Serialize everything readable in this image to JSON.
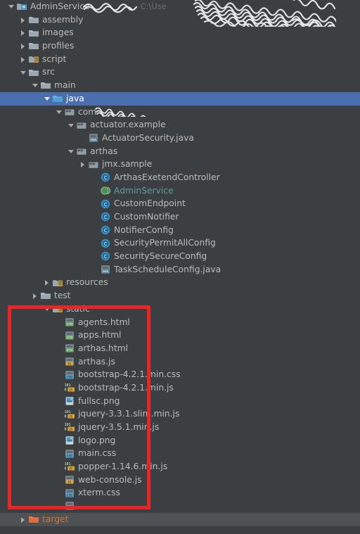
{
  "window": {
    "type": "ide-project-tree",
    "background": "#3c3f41",
    "selection_color": "#4b6eaf",
    "annotation_box_color": "#ee2222"
  },
  "header": {
    "module_name": "AdminService",
    "path_hint": "C:\\Use"
  },
  "tree": [
    {
      "id": "adminservice",
      "label": "AdminService",
      "depth": 0,
      "arrow": "expanded",
      "icon": "module-icon",
      "color": "default",
      "redacted_after": true,
      "path_hint": "C:\\Use"
    },
    {
      "id": "assembly",
      "label": "assembly",
      "depth": 1,
      "arrow": "collapsed",
      "icon": "folder-icon",
      "color": "default"
    },
    {
      "id": "images",
      "label": "images",
      "depth": 1,
      "arrow": "collapsed",
      "icon": "folder-icon",
      "color": "default"
    },
    {
      "id": "profiles",
      "label": "profiles",
      "depth": 1,
      "arrow": "collapsed",
      "icon": "folder-icon",
      "color": "default"
    },
    {
      "id": "script",
      "label": "script",
      "depth": 1,
      "arrow": "collapsed",
      "icon": "resource-folder-icon",
      "color": "default"
    },
    {
      "id": "src",
      "label": "src",
      "depth": 1,
      "arrow": "expanded",
      "icon": "folder-icon",
      "color": "default"
    },
    {
      "id": "main",
      "label": "main",
      "depth": 2,
      "arrow": "expanded",
      "icon": "folder-icon",
      "color": "default"
    },
    {
      "id": "java",
      "label": "java",
      "depth": 3,
      "arrow": "expanded",
      "icon": "source-folder-icon",
      "color": "default",
      "selected": true
    },
    {
      "id": "com-package",
      "label": "com",
      "depth": 4,
      "arrow": "expanded",
      "icon": "package-icon",
      "color": "default",
      "redacted_after": true
    },
    {
      "id": "actuator-example",
      "label": "actuator.example",
      "depth": 5,
      "arrow": "expanded",
      "icon": "package-icon",
      "color": "default"
    },
    {
      "id": "actuatorsecurity-java",
      "label": "ActuatorSecurity.java",
      "depth": 6,
      "arrow": "none",
      "icon": "java-file-icon",
      "color": "default"
    },
    {
      "id": "arthas-package",
      "label": "arthas",
      "depth": 5,
      "arrow": "expanded",
      "icon": "package-icon",
      "color": "default"
    },
    {
      "id": "jmx-sample",
      "label": "jmx.sample",
      "depth": 6,
      "arrow": "collapsed",
      "icon": "package-icon",
      "color": "default"
    },
    {
      "id": "arthasexetendcontroller",
      "label": "ArthasExetendController",
      "depth": 7,
      "arrow": "none",
      "icon": "class-icon",
      "color": "default"
    },
    {
      "id": "adminservice-class",
      "label": "AdminService",
      "depth": 7,
      "arrow": "none",
      "icon": "spring-class-icon",
      "color": "teal"
    },
    {
      "id": "customendpoint",
      "label": "CustomEndpoint",
      "depth": 7,
      "arrow": "none",
      "icon": "class-icon",
      "color": "default"
    },
    {
      "id": "customnotifier",
      "label": "CustomNotifier",
      "depth": 7,
      "arrow": "none",
      "icon": "class-icon",
      "color": "default"
    },
    {
      "id": "notifierconfig",
      "label": "NotifierConfig",
      "depth": 7,
      "arrow": "none",
      "icon": "class-icon",
      "color": "default"
    },
    {
      "id": "securitypermitallconfig",
      "label": "SecurityPermitAllConfig",
      "depth": 7,
      "arrow": "none",
      "icon": "class-icon",
      "color": "default"
    },
    {
      "id": "securitysecureconfig",
      "label": "SecuritySecureConfig",
      "depth": 7,
      "arrow": "none",
      "icon": "class-icon",
      "color": "default"
    },
    {
      "id": "taskscheduleconfig-java",
      "label": "TaskScheduleConfig.java",
      "depth": 7,
      "arrow": "none",
      "icon": "java-file-icon",
      "color": "default"
    },
    {
      "id": "resources",
      "label": "resources",
      "depth": 3,
      "arrow": "collapsed",
      "icon": "resource-folder-icon",
      "color": "default"
    },
    {
      "id": "test",
      "label": "test",
      "depth": 2,
      "arrow": "collapsed",
      "icon": "folder-icon",
      "color": "default"
    },
    {
      "id": "static",
      "label": "static",
      "depth": 3,
      "arrow": "expanded",
      "icon": "resource-folder-icon",
      "color": "default"
    },
    {
      "id": "agents-html",
      "label": "agents.html",
      "depth": 4,
      "arrow": "none",
      "icon": "html-file-icon",
      "color": "default"
    },
    {
      "id": "apps-html",
      "label": "apps.html",
      "depth": 4,
      "arrow": "none",
      "icon": "html-file-icon",
      "color": "default"
    },
    {
      "id": "arthas-html",
      "label": "arthas.html",
      "depth": 4,
      "arrow": "none",
      "icon": "html-file-icon",
      "color": "default"
    },
    {
      "id": "arthas-js",
      "label": "arthas.js",
      "depth": 4,
      "arrow": "none",
      "icon": "js-file-icon",
      "color": "default"
    },
    {
      "id": "bootstrap-css",
      "label": "bootstrap-4.2.1.min.css",
      "depth": 4,
      "arrow": "none",
      "icon": "css-file-icon",
      "color": "default"
    },
    {
      "id": "bootstrap-js",
      "label": "bootstrap-4.2.1.min.js",
      "depth": 4,
      "arrow": "none",
      "icon": "minjs-file-icon",
      "color": "default"
    },
    {
      "id": "fullsc-png",
      "label": "fullsc.png",
      "depth": 4,
      "arrow": "none",
      "icon": "image-file-icon",
      "color": "default"
    },
    {
      "id": "jquery-slim-js",
      "label": "jquery-3.3.1.slim.min.js",
      "depth": 4,
      "arrow": "none",
      "icon": "minjs-file-icon",
      "color": "default"
    },
    {
      "id": "jquery-min-js",
      "label": "jquery-3.5.1.min.js",
      "depth": 4,
      "arrow": "none",
      "icon": "minjs-file-icon",
      "color": "default"
    },
    {
      "id": "logo-png",
      "label": "logo.png",
      "depth": 4,
      "arrow": "none",
      "icon": "image-file-icon",
      "color": "default"
    },
    {
      "id": "main-css",
      "label": "main.css",
      "depth": 4,
      "arrow": "none",
      "icon": "css-file-icon",
      "color": "default"
    },
    {
      "id": "popper-js",
      "label": "popper-1.14.6.min.js",
      "depth": 4,
      "arrow": "none",
      "icon": "minjs-file-icon",
      "color": "default"
    },
    {
      "id": "web-console-js",
      "label": "web-console.js",
      "depth": 4,
      "arrow": "none",
      "icon": "js-file-icon",
      "color": "default"
    },
    {
      "id": "xterm-css",
      "label": "xterm.css",
      "depth": 4,
      "arrow": "none",
      "icon": "css-file-icon",
      "color": "default"
    },
    {
      "id": "partial-hidden-row",
      "label": "",
      "depth": 4,
      "arrow": "none",
      "icon": "css-file-icon",
      "color": "default"
    },
    {
      "id": "target",
      "label": "target",
      "depth": 1,
      "arrow": "collapsed",
      "icon": "excluded-folder-icon",
      "color": "orange",
      "hover": true
    }
  ]
}
